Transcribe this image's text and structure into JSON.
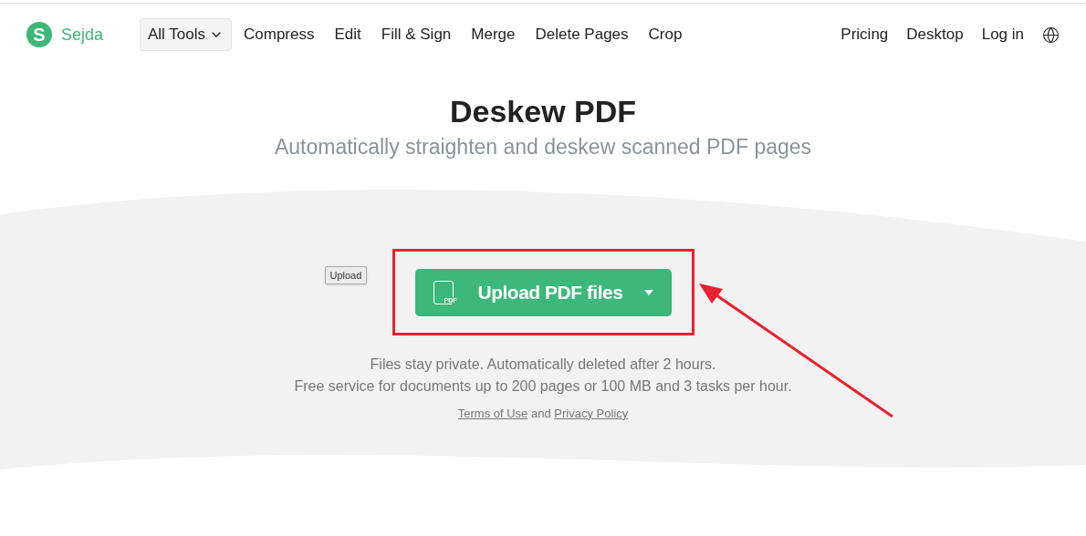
{
  "brand": {
    "mark": "S",
    "name": "Sejda"
  },
  "nav": {
    "all_tools": "All Tools",
    "links": [
      "Compress",
      "Edit",
      "Fill & Sign",
      "Merge",
      "Delete Pages",
      "Crop"
    ],
    "right_links": [
      "Pricing",
      "Desktop",
      "Log in"
    ]
  },
  "title": "Deskew PDF",
  "subtitle": "Automatically straighten and deskew scanned PDF pages",
  "tooltip": "Upload",
  "upload_button": {
    "label": "Upload PDF files",
    "icon_text": "PDF"
  },
  "notes": [
    "Files stay private. Automatically deleted after 2 hours.",
    "Free service for documents up to 200 pages or 100 MB and 3 tasks per hour."
  ],
  "legal": {
    "terms": "Terms of Use",
    "joiner": "and",
    "privacy": "Privacy Policy"
  }
}
